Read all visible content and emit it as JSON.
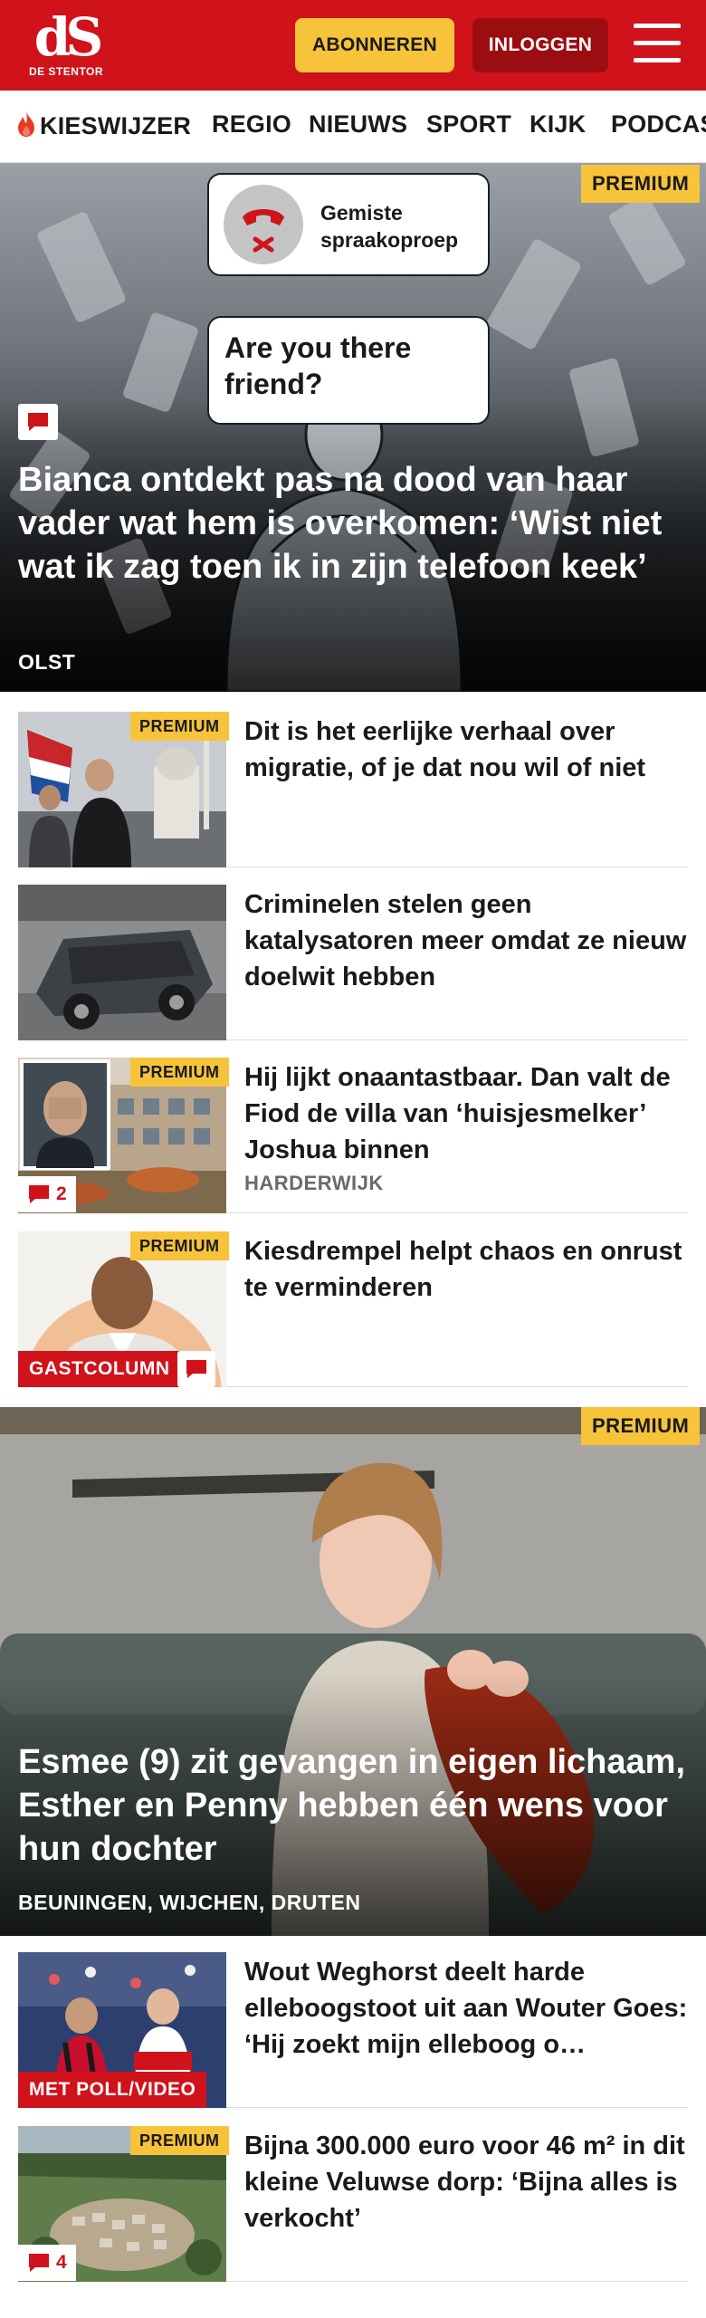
{
  "header": {
    "logo_mark": "dS",
    "logo_sub": "DE STENTOR",
    "subscribe_label": "ABONNEREN",
    "login_label": "INLOGGEN",
    "brand_color": "#d0121b"
  },
  "nav": {
    "items": [
      "KIESWIJZER",
      "REGIO",
      "NIEUWS",
      "SPORT",
      "KIJK",
      "PODCAST"
    ]
  },
  "hero1": {
    "badge": "PREMIUM",
    "card1_text": "Gemiste spraakoproep",
    "card2_text": "Are you there friend?",
    "title": "Bianca ontdekt pas na dood van haar vader wat hem is overkomen: ‘Wist niet wat ik zag toen ik in zijn telefoon keek’",
    "location": "OLST"
  },
  "articles": [
    {
      "badge": "PREMIUM",
      "title": "Dit is het eerlijke verhaal over migratie, of je dat nou wil of niet"
    },
    {
      "title": "Criminelen stelen geen katalysatoren meer omdat ze nieuw doelwit hebben"
    },
    {
      "badge": "PREMIUM",
      "title": "Hij lijkt onaantastbaar. Dan valt de Fiod de villa van ‘huisjesmel­ker’ Joshua binnen",
      "location": "HARDERWIJK",
      "comments": "2"
    },
    {
      "badge": "PREMIUM",
      "title": "Kiesdrempel helpt chaos en onrust te verminderen",
      "label": "GASTCOLUMN"
    }
  ],
  "hero2": {
    "badge": "PREMIUM",
    "title": "Esmee (9) zit gevangen in eigen lichaam, Esther en Penny hebben één wens voor hun dochter",
    "location": "BEUNINGEN, WIJCHEN, DRUTEN"
  },
  "articles2": [
    {
      "title": "Wout Weghorst deelt harde elleboogstoot uit aan Wouter Goes: ‘Hij zoekt mijn elleboog o…",
      "label": "MET POLL/VIDEO"
    },
    {
      "badge": "PREMIUM",
      "title": "Bijna 300.000 euro voor 46 m² in dit kleine Veluwse dorp: ‘Bijna alles is verkocht’",
      "comments": "4"
    }
  ],
  "icons": [
    "flame-icon",
    "menu-icon",
    "comment-icon",
    "phone-missed-icon"
  ]
}
